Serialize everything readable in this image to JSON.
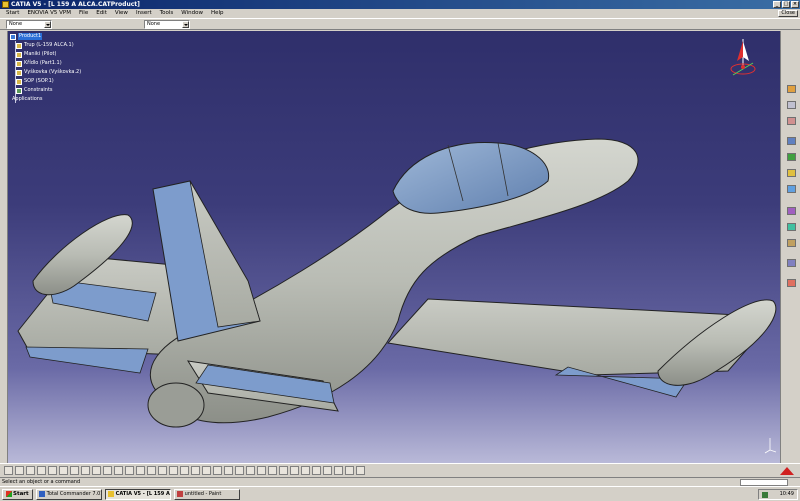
{
  "window": {
    "title": "CATIA V5 - [L 159 A  ALCA.CATProduct]",
    "close_label": "Close"
  },
  "menu": [
    "Start",
    "ENOVIA V5 VPM",
    "File",
    "Edit",
    "View",
    "Insert",
    "Tools",
    "Window",
    "Help"
  ],
  "toolbar_top": {
    "combo1_value": "None",
    "combo2_value": "None"
  },
  "tree": {
    "root": "Product1",
    "nodes": [
      "Trup (L-159 ALCA.1)",
      "Maniki (Pilot)",
      "Křídlo (Part1.1)",
      "Vyškovka (Vyškovka.2)",
      "SOP (SOP.1)",
      "Constraints",
      "Applications"
    ]
  },
  "status": {
    "text": "Select an object or a command"
  },
  "taskbar": {
    "start_label": "Start",
    "tasks": [
      {
        "label": "Total Commander 7.01 - ...",
        "active": false
      },
      {
        "label": "CATIA V5 - [L 159 A  A...",
        "active": true
      },
      {
        "label": "untitled - Paint",
        "active": false
      }
    ],
    "clock": "10:49"
  },
  "colors": {
    "viewport_top": "#2f2f6b",
    "viewport_bottom": "#b9b9d8",
    "fuselage": "#b9bcb4",
    "accent_blue": "#7d9ccc",
    "title_bar": "#0a246a"
  }
}
